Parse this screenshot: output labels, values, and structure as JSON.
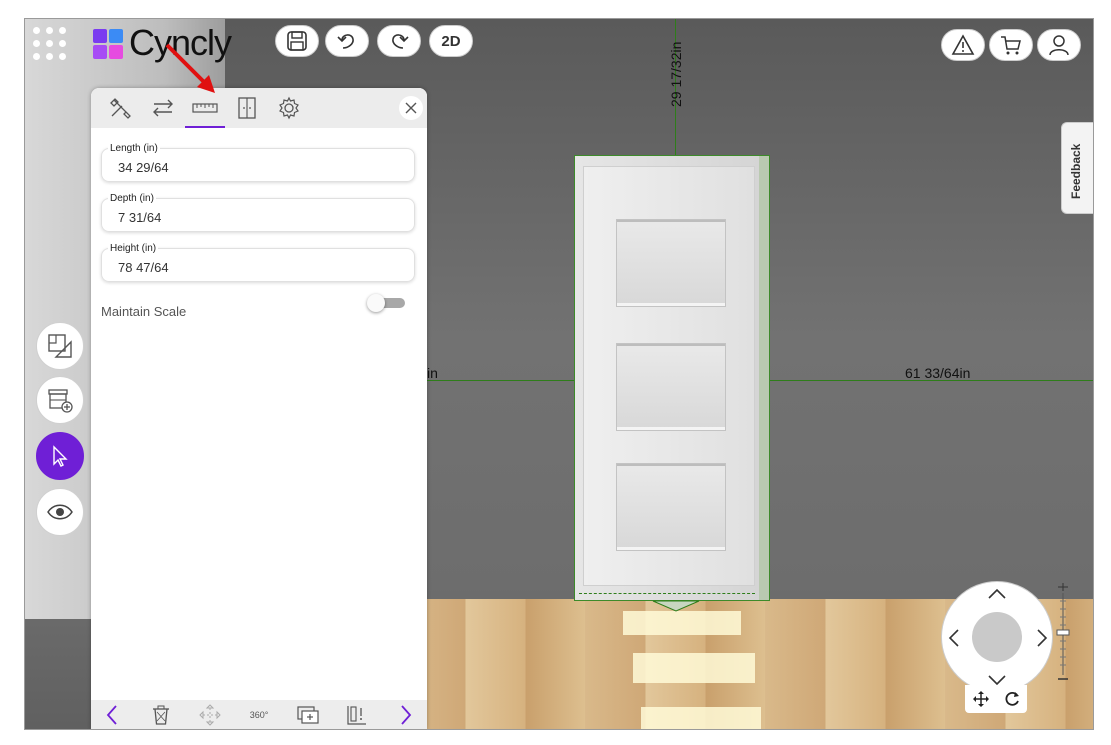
{
  "brand": {
    "name": "Cyncly"
  },
  "top_toolbar": {
    "save_icon": "save-icon",
    "undo_icon": "undo-icon",
    "redo_icon": "redo-icon",
    "view_mode_label": "2D"
  },
  "top_right": {
    "warning_icon": "warning-icon",
    "cart_icon": "cart-icon",
    "account_icon": "user-icon"
  },
  "feedback_label": "Feedback",
  "dimensions": {
    "top_distance": "29 17/32in",
    "right_distance": "61 33/64in",
    "left_distance_fragment": "in"
  },
  "left_tools": [
    {
      "name": "floorplan-tool-button",
      "icon": "floorplan-icon"
    },
    {
      "name": "add-product-button",
      "icon": "add-cabinet-icon"
    },
    {
      "name": "select-tool-button",
      "icon": "cursor-icon",
      "active": true
    },
    {
      "name": "view-tool-button",
      "icon": "eye-icon"
    }
  ],
  "panel": {
    "tabs": [
      {
        "icon": "tools-icon"
      },
      {
        "icon": "swap-icon"
      },
      {
        "icon": "ruler-icon",
        "active": true
      },
      {
        "icon": "door-icon"
      },
      {
        "icon": "gear-icon"
      }
    ],
    "fields": [
      {
        "label": "Length (in)",
        "value": "34 29/64"
      },
      {
        "label": "Depth (in)",
        "value": "7 31/64"
      },
      {
        "label": "Height (in)",
        "value": "78 47/64"
      }
    ],
    "maintain_scale": {
      "label": "Maintain Scale",
      "on": false
    },
    "bottom_bar": {
      "prev_icon": "chevron-left-icon",
      "delete_icon": "trash-icon",
      "move_icon": "move-icon",
      "rotate_icon_text": "360°",
      "duplicate_icon": "duplicate-icon",
      "align_icon": "align-icon",
      "next_icon": "chevron-right-icon"
    }
  },
  "colors": {
    "accent": "#6f1fd6",
    "dimension_line": "#2e7d1a",
    "annotation_arrow": "#e01010"
  }
}
